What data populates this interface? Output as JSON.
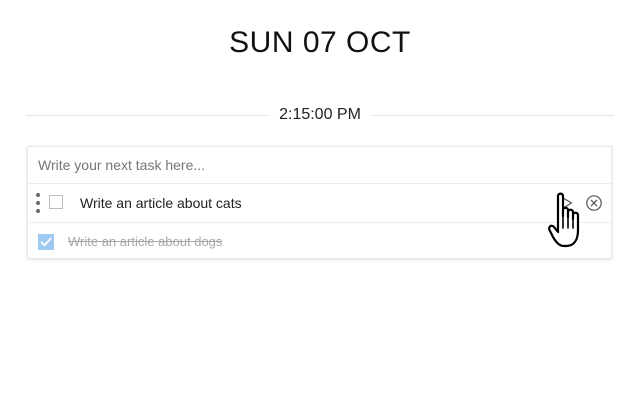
{
  "header": {
    "date": "SUN 07 OCT"
  },
  "clock": {
    "time": "2:15:00 PM"
  },
  "new_task": {
    "placeholder": "Write your next task here...",
    "value": ""
  },
  "tasks": [
    {
      "text": "Write an article about cats",
      "completed": false
    },
    {
      "text": "Write an article about dogs",
      "completed": true
    }
  ],
  "colors": {
    "checked_fill": "#9ec9f1",
    "completed_text": "#a8a8a8",
    "divider": "#e3e3e3"
  },
  "icons": {
    "start": "play-icon",
    "delete": "close-icon",
    "drag": "drag-handle-icon",
    "check": "checkmark-icon",
    "pointer": "hand-pointer-cursor"
  }
}
